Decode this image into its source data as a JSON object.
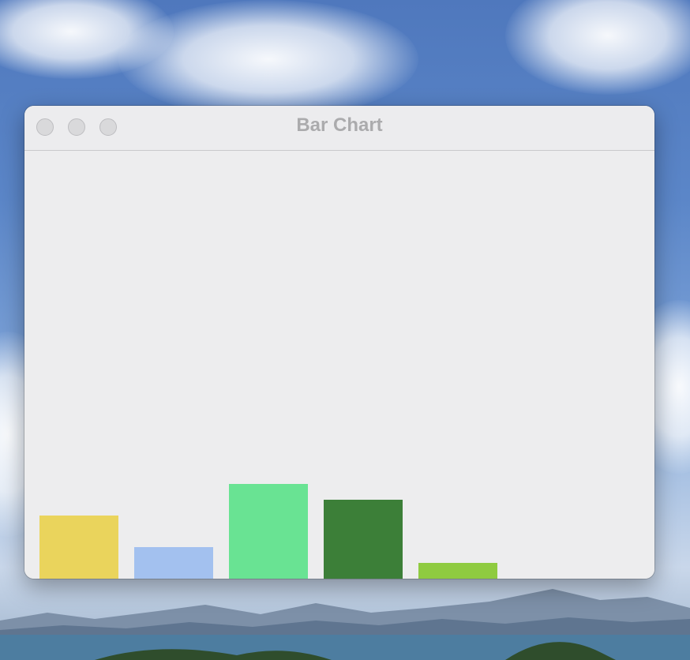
{
  "window": {
    "title": "Bar Chart"
  },
  "chart_data": {
    "type": "bar",
    "categories": [
      "",
      "",
      "",
      "",
      ""
    ],
    "values": [
      80,
      40,
      120,
      100,
      20
    ],
    "colors": [
      "#ead45c",
      "#a3c1ef",
      "#69e393",
      "#3c7f38",
      "#8fcb40"
    ],
    "title": "",
    "xlabel": "",
    "ylabel": "",
    "ylim": [
      0,
      542
    ],
    "grid": false,
    "legend": "none"
  }
}
